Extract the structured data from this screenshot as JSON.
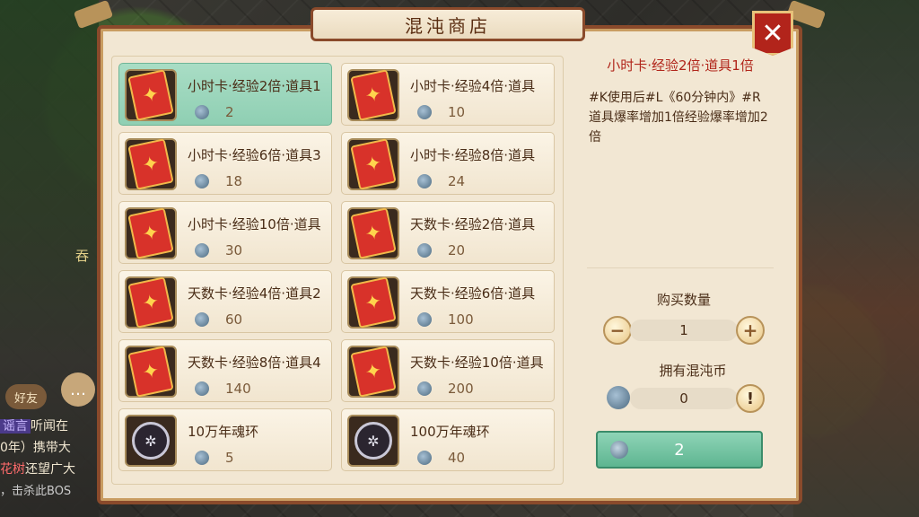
{
  "panel": {
    "title": "混沌商店",
    "close_label": "✕"
  },
  "items": [
    {
      "name": "小时卡·经验2倍·道具1",
      "price": "2",
      "icon": "exp-card-icon",
      "selected": true
    },
    {
      "name": "小时卡·经验4倍·道具",
      "price": "10",
      "icon": "exp-card-icon"
    },
    {
      "name": "小时卡·经验6倍·道具3",
      "price": "18",
      "icon": "exp-card-icon"
    },
    {
      "name": "小时卡·经验8倍·道具",
      "price": "24",
      "icon": "exp-card-icon"
    },
    {
      "name": "小时卡·经验10倍·道具",
      "price": "30",
      "icon": "exp-card-icon"
    },
    {
      "name": "天数卡·经验2倍·道具",
      "price": "20",
      "icon": "exp-card-icon"
    },
    {
      "name": "天数卡·经验4倍·道具2",
      "price": "60",
      "icon": "exp-card-icon"
    },
    {
      "name": "天数卡·经验6倍·道具",
      "price": "100",
      "icon": "exp-card-icon"
    },
    {
      "name": "天数卡·经验8倍·道具4",
      "price": "140",
      "icon": "exp-card-icon"
    },
    {
      "name": "天数卡·经验10倍·道具",
      "price": "200",
      "icon": "exp-card-icon"
    },
    {
      "name": "10万年魂环",
      "price": "5",
      "icon": "soul-ring-icon"
    },
    {
      "name": "100万年魂环",
      "price": "40",
      "icon": "soul-ring-icon"
    }
  ],
  "detail": {
    "title": "小时卡·经验2倍·道具1倍",
    "description": "#K使用后#L《60分钟内》#R道具爆率增加1倍经验爆率增加2倍"
  },
  "purchase": {
    "qty_label": "购买数量",
    "qty_value": "1",
    "minus_label": "−",
    "plus_label": "+",
    "own_label": "拥有混沌币",
    "own_value": "0",
    "own_info_label": "!",
    "buy_price": "2"
  },
  "hud": {
    "friend_label": "好友",
    "side_char": "吞",
    "chat": [
      {
        "tag": "谣言",
        "text": "听闻在"
      },
      {
        "tag": "",
        "text": "0年）携带大"
      },
      {
        "tag": "花树",
        "text": "还望广大"
      },
      {
        "tag": "",
        "text": "，击杀此BOS"
      }
    ]
  },
  "colors": {
    "accent_red": "#b1261b",
    "selected_green": "#8fcfb3",
    "frame_brown": "#8a4a2b"
  }
}
